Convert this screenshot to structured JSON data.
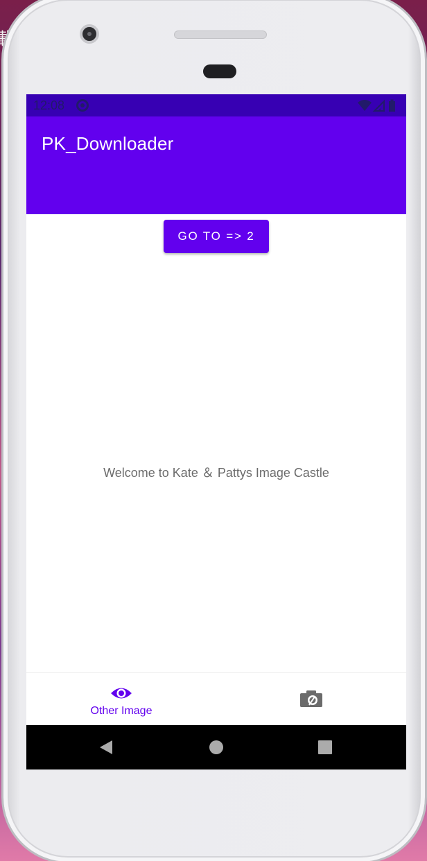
{
  "side_glyph": "載",
  "status_bar": {
    "time": "12:08",
    "icons": [
      "sync-icon",
      "wifi-icon",
      "signal-icon",
      "battery-icon"
    ]
  },
  "app_bar": {
    "title": "PK_Downloader"
  },
  "main": {
    "goto_button_label": "GO TO => 2",
    "welcome_text": "Welcome to Kate ＆ Pattys Image Castle"
  },
  "bottom_nav": {
    "items": [
      {
        "label": "Other Image",
        "icon": "eye-icon",
        "selected": true
      },
      {
        "label": "",
        "icon": "camera-icon",
        "selected": false
      }
    ]
  },
  "system_nav": {
    "buttons": [
      "back-icon",
      "home-icon",
      "recents-icon"
    ]
  },
  "colors": {
    "primary": "#6200ee",
    "status_bar": "#3700b3",
    "text_secondary": "#6b6b6b"
  }
}
